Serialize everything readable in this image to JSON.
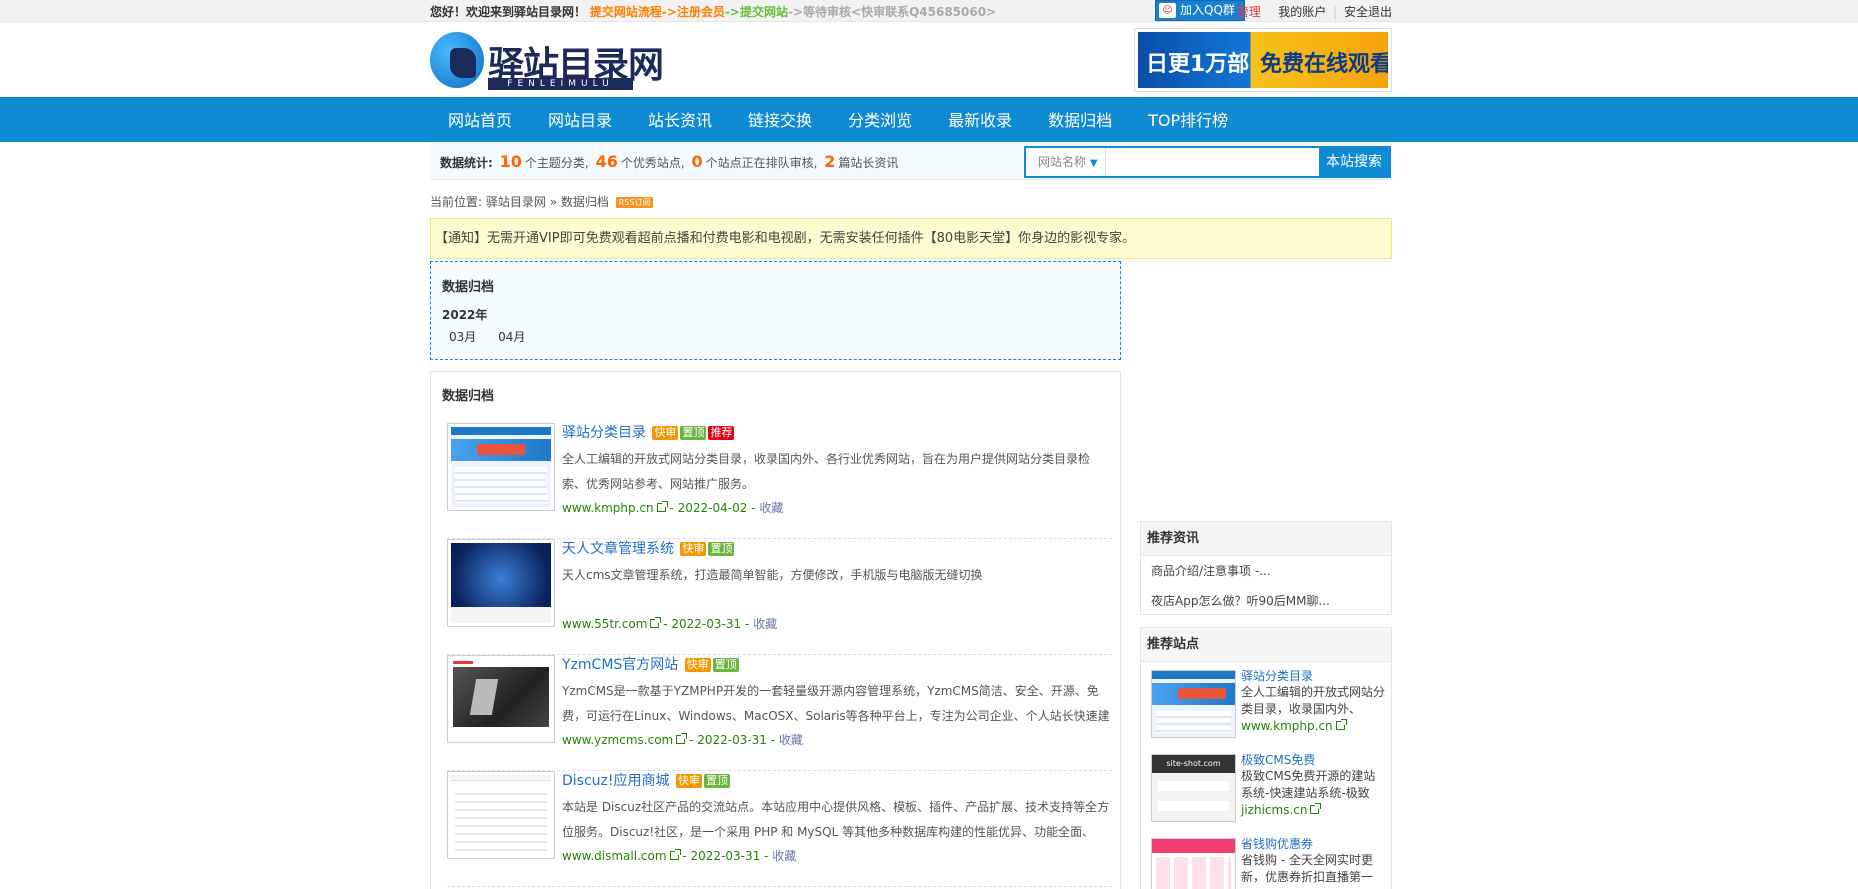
{
  "topbar": {
    "welcome": "您好！欢迎来到驿站目录网！",
    "flow_submit": "提交网站流程",
    "arrow1": "->",
    "register": "注册会员",
    "arrow2": "->",
    "submit_site": "提交网站",
    "arrow3": "->",
    "wait_review": "等待审核<快审联系Q45685060>",
    "qq_group": "加入QQ群",
    "admin": "管理",
    "my_account": "我的账户",
    "logout": "安全退出"
  },
  "logo": {
    "title": "驿站目录网",
    "subtitle": "FENLEIMULU"
  },
  "banner": {
    "left_text": "日更1万部",
    "right_text": "免费在线观看"
  },
  "nav": {
    "items": [
      "网站首页",
      "网站目录",
      "站长资讯",
      "链接交换",
      "分类浏览",
      "最新收录",
      "数据归档",
      "TOP排行榜"
    ]
  },
  "stats": {
    "label": "数据统计:",
    "categories_count": "10",
    "categories_text": "个主题分类,",
    "sites_count": "46",
    "sites_text": "个优秀站点,",
    "pending_count": "0",
    "pending_text": "个站点正在排队审核,",
    "news_count": "2",
    "news_text": "篇站长资讯"
  },
  "search": {
    "scope": "网站名称",
    "placeholder": "",
    "button": "本站搜索"
  },
  "breadcrumb": {
    "prefix": "当前位置:",
    "home": "驿站目录网",
    "sep": "»",
    "current": "数据归档",
    "rss": "RSS订阅"
  },
  "notice": "【通知】无需开通VIP即可免费观看超前点播和付费电影和电视剧，无需安装任何插件【80电影天堂】你身边的影视专家。",
  "archive": {
    "title": "数据归档",
    "year": "2022年",
    "months": [
      "03月",
      "04月"
    ]
  },
  "listing": {
    "title": "数据归档",
    "items": [
      {
        "name": "驿站分类目录",
        "tags": [
          "快审",
          "置顶",
          "推荐"
        ],
        "desc": "全人工编辑的开放式网站分类目录，收录国内外、各行业优秀网站，旨在为用户提供网站分类目录检索、优秀网站参考、网站推广服务。",
        "url": "www.kmphp.cn",
        "date": "- 2022-04-02 -",
        "fav": "收藏"
      },
      {
        "name": "天人文章管理系统",
        "tags": [
          "快审",
          "置顶"
        ],
        "desc": "天人cms文章管理系统，打造最简单智能，方便修改，手机版与电脑版无缝切换",
        "url": "www.55tr.com",
        "date": "- 2022-03-31 -",
        "fav": "收藏"
      },
      {
        "name": "YzmCMS官方网站",
        "tags": [
          "快审",
          "置顶"
        ],
        "desc": "YzmCMS是一款基于YZMPHP开发的一套轻量级开源内容管理系统，YzmCMS简洁、安全、开源、免费，可运行在Linux、Windows、MacOSX、Solaris等各种平台上，专注为公司企业、个人站长快速建站提供解决",
        "url": "www.yzmcms.com",
        "date": "- 2022-03-31 -",
        "fav": "收藏"
      },
      {
        "name": "Discuz!应用商城",
        "tags": [
          "快审",
          "置顶"
        ],
        "desc": "本站是 Discuz社区产品的交流站点。本站应用中心提供风格、模板、插件、产品扩展、技术支持等全方位服务。Discuz!社区，是一个采用 PHP 和 MySQL 等其他多种数据库构建的性能优异、功能全面、",
        "url": "www.dismall.com",
        "date": "- 2022-03-31 -",
        "fav": "收藏"
      }
    ]
  },
  "sidebar": {
    "news_title": "推荐资讯",
    "news": [
      "商品介绍/注意事项 -...",
      "夜店App怎么做？听90后MM聊..."
    ],
    "sites_title": "推荐站点",
    "sites": [
      {
        "name": "驿站分类目录",
        "desc": "全人工编辑的开放式网站分类目录，收录国内外、",
        "url": "www.kmphp.cn"
      },
      {
        "name": "极致CMS免费",
        "desc": "极致CMS免费开源的建站系统-快速建站系统-极致",
        "url": "jizhicms.cn",
        "thumb_title": "site-shot.com"
      },
      {
        "name": "省钱购优惠券",
        "desc": "省钱购 - 全天全网实时更新，优惠券折扣直播第一",
        "url": ""
      }
    ]
  }
}
